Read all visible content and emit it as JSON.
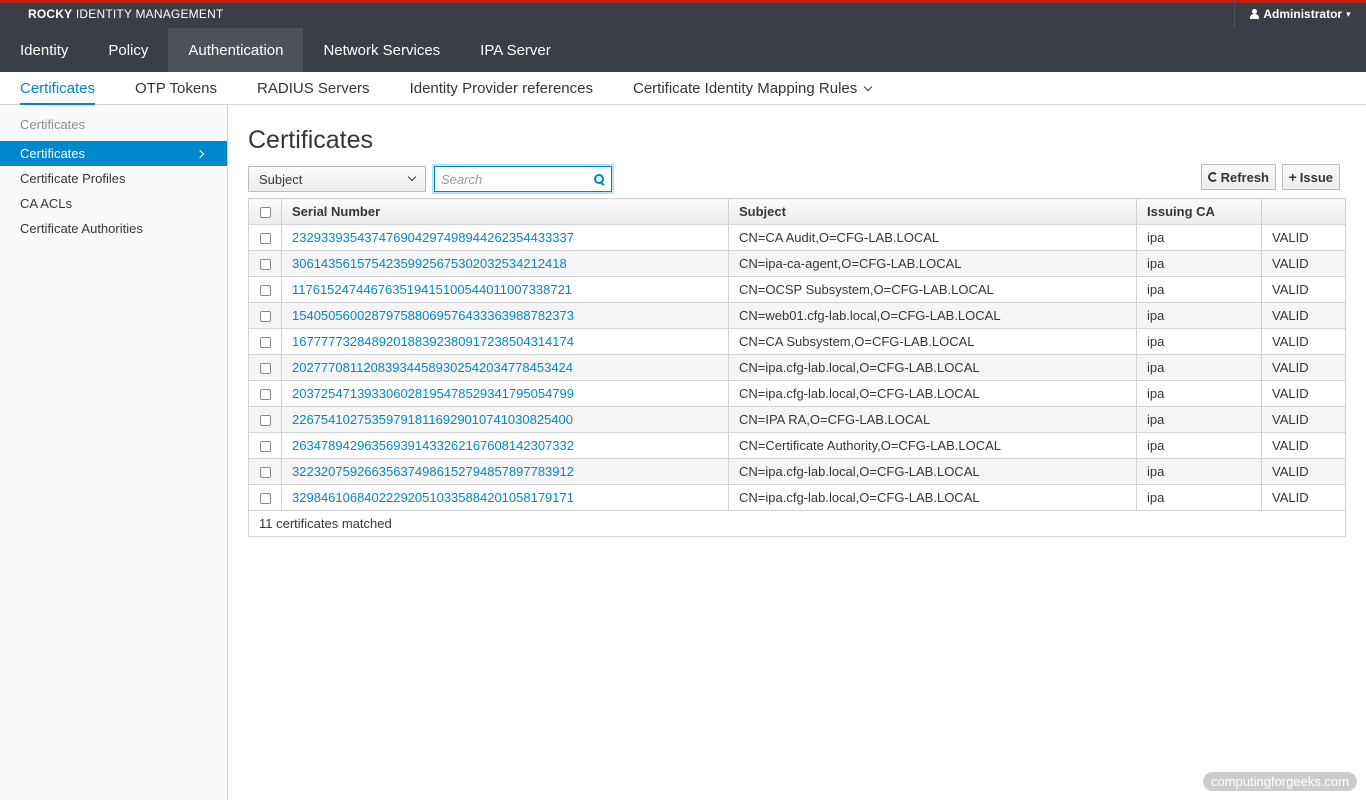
{
  "header": {
    "brand_strong": "ROCKY",
    "brand_rest": " IDENTITY MANAGEMENT",
    "user": "Administrator"
  },
  "main_nav": [
    "Identity",
    "Policy",
    "Authentication",
    "Network Services",
    "IPA Server"
  ],
  "sub_nav": [
    "Certificates",
    "OTP Tokens",
    "RADIUS Servers",
    "Identity Provider references",
    "Certificate Identity Mapping Rules"
  ],
  "sidebar": {
    "heading": "Certificates",
    "items": [
      "Certificates",
      "Certificate Profiles",
      "CA ACLs",
      "Certificate Authorities"
    ]
  },
  "page": {
    "title": "Certificates",
    "filter_select": "Subject",
    "search_placeholder": "Search",
    "refresh_label": "Refresh",
    "issue_label": "Issue"
  },
  "table": {
    "columns": [
      "Serial Number",
      "Subject",
      "Issuing CA",
      ""
    ],
    "rows": [
      {
        "serial": "232933935437476904297498944262354433337",
        "subject": "CN=CA Audit,O=CFG-LAB.LOCAL",
        "ca": "ipa",
        "status": "VALID"
      },
      {
        "serial": "30614356157542359925675302032534212418",
        "subject": "CN=ipa-ca-agent,O=CFG-LAB.LOCAL",
        "ca": "ipa",
        "status": "VALID"
      },
      {
        "serial": "117615247446763519415100544011007338721",
        "subject": "CN=OCSP Subsystem,O=CFG-LAB.LOCAL",
        "ca": "ipa",
        "status": "VALID"
      },
      {
        "serial": "154050560028797588069576433363988782373",
        "subject": "CN=web01.cfg-lab.local,O=CFG-LAB.LOCAL",
        "ca": "ipa",
        "status": "VALID"
      },
      {
        "serial": "167777732848920188392380917238504314174",
        "subject": "CN=CA Subsystem,O=CFG-LAB.LOCAL",
        "ca": "ipa",
        "status": "VALID"
      },
      {
        "serial": "202777081120839344589302542034778453424",
        "subject": "CN=ipa.cfg-lab.local,O=CFG-LAB.LOCAL",
        "ca": "ipa",
        "status": "VALID"
      },
      {
        "serial": "203725471393306028195478529341795054799",
        "subject": "CN=ipa.cfg-lab.local,O=CFG-LAB.LOCAL",
        "ca": "ipa",
        "status": "VALID"
      },
      {
        "serial": "226754102753597918116929010741030825400",
        "subject": "CN=IPA RA,O=CFG-LAB.LOCAL",
        "ca": "ipa",
        "status": "VALID"
      },
      {
        "serial": "263478942963569391433262167608142307332",
        "subject": "CN=Certificate Authority,O=CFG-LAB.LOCAL",
        "ca": "ipa",
        "status": "VALID"
      },
      {
        "serial": "322320759266356374986152794857897783912",
        "subject": "CN=ipa.cfg-lab.local,O=CFG-LAB.LOCAL",
        "ca": "ipa",
        "status": "VALID"
      },
      {
        "serial": "329846106840222920510335884201058179171",
        "subject": "CN=ipa.cfg-lab.local,O=CFG-LAB.LOCAL",
        "ca": "ipa",
        "status": "VALID"
      }
    ],
    "footer": "11 certificates matched"
  },
  "watermark": "computingforgeeks.com",
  "colors": {
    "accent": "#0088ce",
    "header_bg": "#393f44",
    "top_stripe": "#c9190b"
  }
}
